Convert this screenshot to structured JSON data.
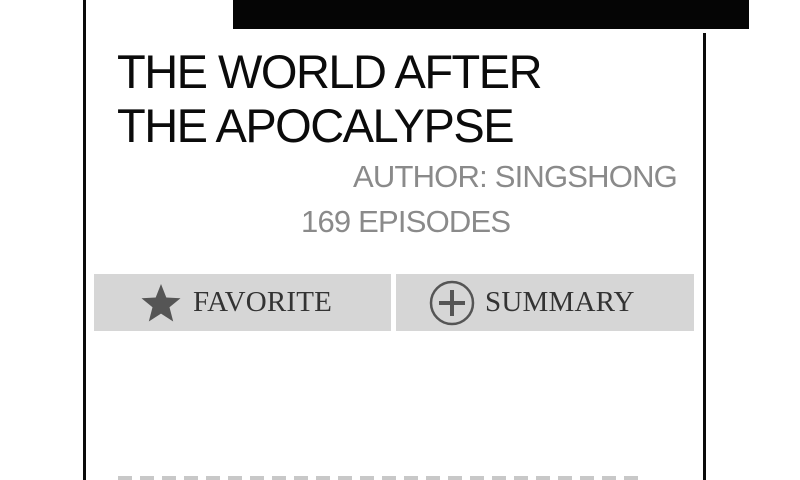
{
  "title": {
    "line1": "THE WORLD AFTER",
    "line2": "THE APOCALYPSE"
  },
  "author": "AUTHOR: SINGSHONG",
  "episodes": "169 EPISODES",
  "buttons": {
    "favorite": {
      "label": "FAVORITE",
      "icon": "star-icon"
    },
    "summary": {
      "label": "SUMMARY",
      "icon": "plus-circle-icon"
    }
  },
  "colors": {
    "background": "#ffffff",
    "frame": "#0a0a0a",
    "title": "#0b0b0b",
    "meta_text": "#8a8a8a",
    "button_bg": "#d6d6d6",
    "button_text": "#333333",
    "icon": "#555555"
  }
}
